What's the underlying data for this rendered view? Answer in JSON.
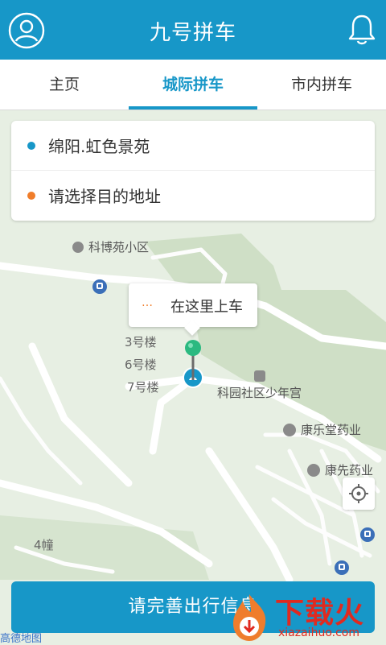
{
  "header": {
    "title": "九号拼车"
  },
  "tabs": [
    {
      "label": "主页"
    },
    {
      "label": "城际拼车"
    },
    {
      "label": "市内拼车"
    }
  ],
  "route": {
    "from": "绵阳.虹色景苑",
    "to_placeholder": "请选择目的地址"
  },
  "map": {
    "labels": {
      "kebo": "科博苑小区",
      "bld3": "3号楼",
      "bld6": "6号楼",
      "bld7": "7号楼",
      "bld4": "4幢",
      "kyouth": "科园社区少年宫",
      "kangle": "康乐堂药业",
      "kangxian": "康先药业"
    },
    "pickup_dots": "…",
    "pickup_text": "在这里上车",
    "logo": "高德地图"
  },
  "actions": {
    "confirm": "请完善出行信息"
  },
  "watermark": {
    "brand": "下载火",
    "url": "xiazaihuo.com"
  },
  "colors": {
    "primary": "#1797c8",
    "origin_dot": "#1797c8",
    "destination_dot": "#f07d2a",
    "pin": "#2bb980"
  },
  "icons": {
    "avatar": "user-circle-icon",
    "bell": "bell-icon",
    "locate": "crosshair-icon"
  }
}
